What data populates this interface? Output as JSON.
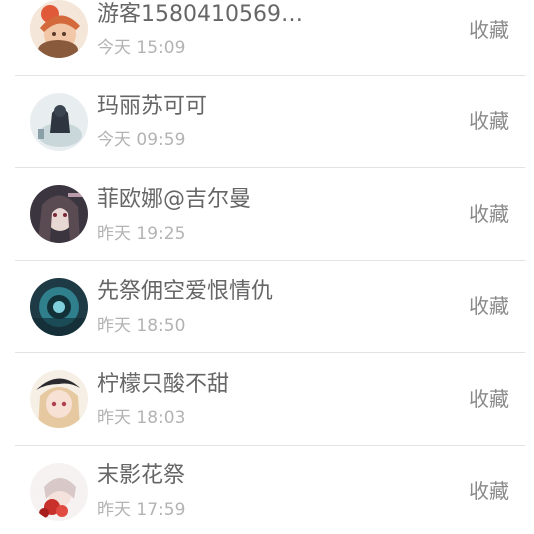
{
  "items": [
    {
      "name": "游客1580410569…",
      "time": "今天 15:09",
      "action": "收藏",
      "avatar_icon": "avatar-anime-girl-hat-icon",
      "accent": "#e8a080"
    },
    {
      "name": "玛丽苏可可",
      "time": "今天 09:59",
      "action": "收藏",
      "avatar_icon": "avatar-dark-figure-icon",
      "accent": "#3a4450"
    },
    {
      "name": "菲欧娜@吉尔曼",
      "time": "昨天 19:25",
      "action": "收藏",
      "avatar_icon": "avatar-gothic-girl-icon",
      "accent": "#5a4a52"
    },
    {
      "name": "先祭佣空爱恨情仇",
      "time": "昨天 18:50",
      "action": "收藏",
      "avatar_icon": "avatar-teal-emblem-icon",
      "accent": "#2f7f8c"
    },
    {
      "name": "柠檬只酸不甜",
      "time": "昨天 18:03",
      "action": "收藏",
      "avatar_icon": "avatar-blonde-girl-beret-icon",
      "accent": "#e6c9a0"
    },
    {
      "name": "末影花祭",
      "time": "昨天 17:59",
      "action": "收藏",
      "avatar_icon": "avatar-red-flower-girl-icon",
      "accent": "#c8302c"
    }
  ]
}
